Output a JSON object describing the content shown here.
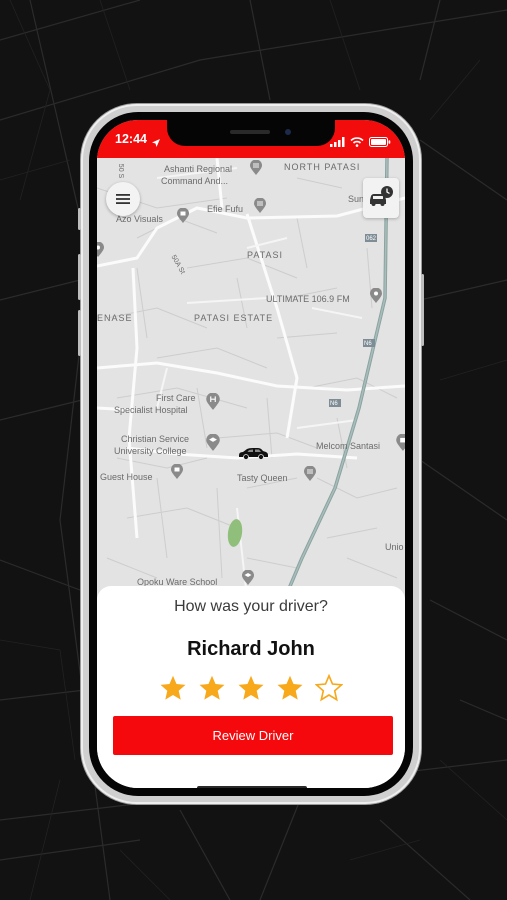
{
  "status_bar": {
    "time": "12:44"
  },
  "map": {
    "labels": {
      "north_patasi": "NORTH PATASI",
      "ashanti_regional_1": "Ashanti Regional",
      "ashanti_regional_2": "Command And...",
      "efie_fufu": "Efie Fufu",
      "azo_visuals": "Azo Visuals",
      "patasi": "PATASI",
      "sun": "Sun",
      "ultimate": "ULTIMATE 106.9 FM",
      "denase": "ENASE",
      "patasi_estate": "PATASI ESTATE",
      "first_care_1": "First Care",
      "first_care_2": "Specialist Hospital",
      "christian_1": "Christian Service",
      "christian_2": "University College",
      "melcom": "Melcom Santasi",
      "guest_house": "Guest House",
      "tasty_queen": "Tasty Queen",
      "union": "Unio",
      "opoku_ware": "Opoku Ware School",
      "road_50a": "50A St",
      "road_50": "50 S",
      "road_n6a": "N6",
      "road_n6b": "N6",
      "road_062": "062"
    }
  },
  "rating": {
    "question": "How was your driver?",
    "driver_name": "Richard John",
    "stars": 4,
    "max_stars": 5,
    "button_label": "Review Driver"
  },
  "colors": {
    "accent": "#f20c0c",
    "star": "#f7a81b"
  }
}
